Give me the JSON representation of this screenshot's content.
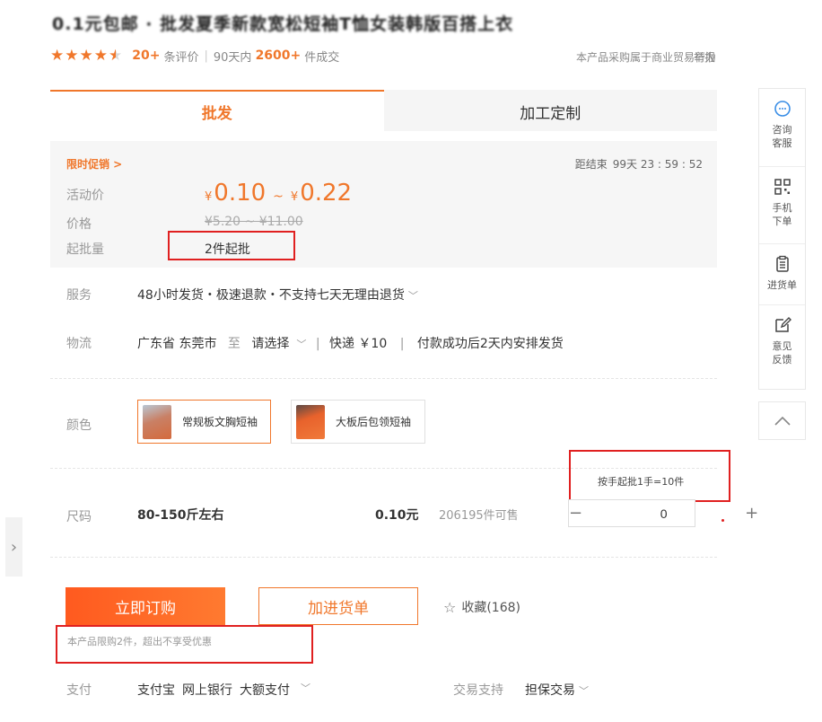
{
  "product": {
    "title": "0.1元包邮 · 批发夏季新款宽松短袖T恤女装韩版百搭上衣",
    "rating_stars": 4.5,
    "review_count": "20+",
    "review_label": "条评价",
    "sales_prefix": "90天内",
    "sales_count": "2600+",
    "sales_label": "件成交",
    "notice": "本产品采购属于商业贸易行为",
    "report": "举报"
  },
  "tabs": [
    {
      "label": "批发",
      "active": true
    },
    {
      "label": "加工定制",
      "active": false
    }
  ],
  "promo": {
    "tag": "限时促销 >",
    "countdown_label": "距结束",
    "countdown": "99天 23 : 59 : 52",
    "activity_price_label": "活动价",
    "currency": "¥",
    "price_low": "0.10",
    "tilde": "~",
    "price_high": "0.22",
    "orig_price_label": "价格",
    "orig_price": "¥5.20  ~  ¥11.00",
    "min_order_label": "起批量",
    "min_order": "2件起批"
  },
  "service": {
    "label": "服务",
    "value": "48小时发货・极速退款・不支持七天无理由退货",
    "chevron": "﹀"
  },
  "logistics": {
    "label": "物流",
    "origin": "广东省 东莞市",
    "to": "至",
    "dest": "请选择",
    "chevron": "﹀",
    "sep": "|",
    "express": "快递 ￥10",
    "sep2": "|",
    "dispatch": "付款成功后2天内安排发货"
  },
  "color": {
    "label": "颜色",
    "options": [
      {
        "label": "常规板文胸短袖",
        "selected": true
      },
      {
        "label": "大板后包领短袖",
        "selected": false
      }
    ]
  },
  "size": {
    "label": "尺码",
    "tip": "按手起批1手=10件",
    "name": "80-150斤左右",
    "price": "0.10元",
    "stock": "206195件可售",
    "minus": "−",
    "qty": "0",
    "plus": "+"
  },
  "actions": {
    "buy": "立即订购",
    "cart": "加进货单",
    "fav_star": "☆",
    "fav": "收藏(168)",
    "limit_note": "本产品限购2件，超出不享受优惠"
  },
  "payment": {
    "label": "支付",
    "methods": [
      "支付宝",
      "网上银行",
      "大额支付"
    ],
    "chevron": "﹀",
    "trade_label": "交易支持",
    "trade_value": "担保交易",
    "trade_chevron": "﹀"
  },
  "sidebar": {
    "items": [
      {
        "icon": "chat-bubble-icon",
        "label": "咨询客服"
      },
      {
        "icon": "qr-code-icon",
        "label": "手机下单"
      },
      {
        "icon": "clipboard-icon",
        "label": "进货单"
      },
      {
        "icon": "edit-icon",
        "label": "意见反馈"
      }
    ],
    "top_icon": "chevron-up-icon"
  },
  "left_arrow_icon": "chevron-right-icon",
  "colors": {
    "accent": "#f0772b",
    "annotation_red": "#e02020",
    "buy_gradient_start": "#ff5a1f",
    "buy_gradient_end": "#ff7a30"
  }
}
